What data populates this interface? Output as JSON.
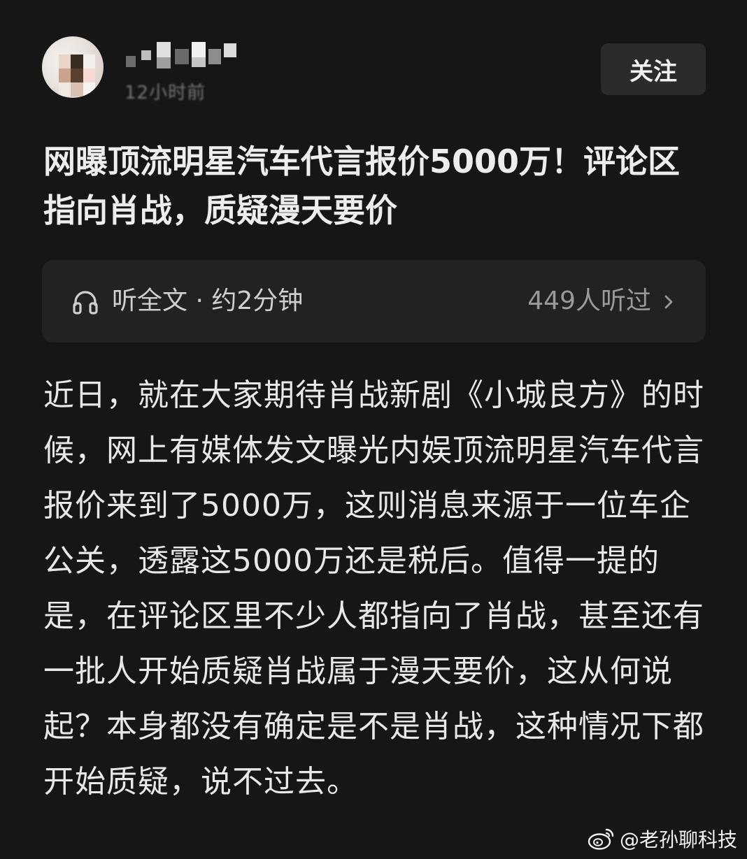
{
  "author": {
    "timestamp": "12小时前"
  },
  "follow_button": {
    "label": "关注"
  },
  "article": {
    "title": "网曝顶流明星汽车代言报价5000万！评论区指向肖战，质疑漫天要价",
    "body": "近日，就在大家期待肖战新剧《小城良方》的时候，网上有媒体发文曝光内娱顶流明星汽车代言报价来到了5000万，这则消息来源于一位车企公关，透露这5000万还是税后。值得一提的是，在评论区里不少人都指向了肖战，甚至还有一批人开始质疑肖战属于漫天要价，这从何说起？本身都没有确定是不是肖战，这种情况下都开始质疑，说不过去。"
  },
  "listen_bar": {
    "label": "听全文 · 约2分钟",
    "count": "449人听过",
    "icon": "headphones-icon"
  },
  "watermark": {
    "text": "@老孙聊科技",
    "icon": "weibo-icon"
  },
  "colors": {
    "background": "#161616",
    "card": "#222222",
    "button": "#2b2b2b",
    "text_primary": "#e8e8e8",
    "text_secondary": "#9a9a9a"
  }
}
